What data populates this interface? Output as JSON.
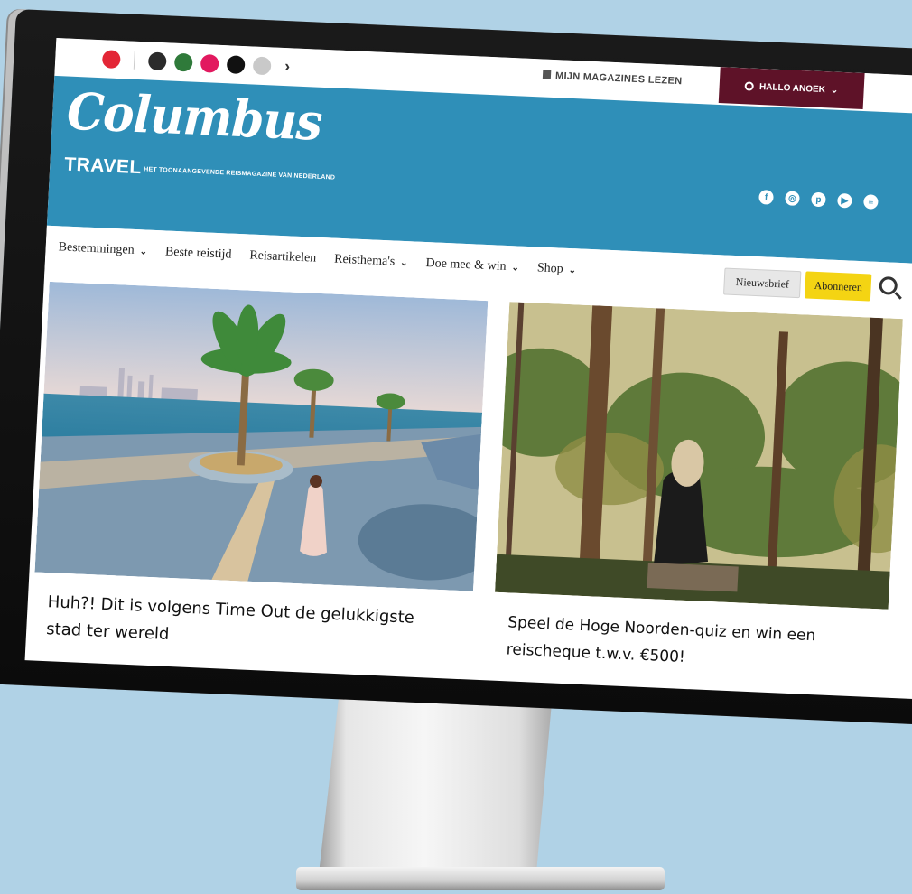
{
  "topbar": {
    "brand_icons": [
      {
        "icon": "red-ring-icon",
        "color": "#e32636"
      },
      {
        "icon": "h-brand-icon",
        "color": "#2b2b2b"
      },
      {
        "icon": "green-figure-icon",
        "color": "#2f7a3a"
      },
      {
        "icon": "pink-brand-icon",
        "color": "#e2195f"
      },
      {
        "icon": "black-brand-icon",
        "color": "#111111"
      },
      {
        "icon": "grey-brand-icon",
        "color": "#c9c9c9"
      }
    ],
    "next_chevron": "›",
    "magazines_label": "MIJN MAGAZINES LEZEN",
    "user_greeting": "HALLO ANOEK",
    "user_chevron": "⌄"
  },
  "header": {
    "logo": "Columbus",
    "logo_sub": "TRAVEL",
    "tagline": "HET TOONAANGEVENDE REISMAGAZINE VAN NEDERLAND",
    "social": [
      {
        "icon": "facebook-icon",
        "glyph": "f"
      },
      {
        "icon": "instagram-icon",
        "glyph": "◎"
      },
      {
        "icon": "pinterest-icon",
        "glyph": "p"
      },
      {
        "icon": "youtube-icon",
        "glyph": "▶"
      },
      {
        "icon": "spotify-icon",
        "glyph": "≡"
      }
    ],
    "bg_color": "#2f8fb8"
  },
  "nav": {
    "items": [
      {
        "label": "Bestemmingen",
        "dropdown": true
      },
      {
        "label": "Beste reistijd",
        "dropdown": false
      },
      {
        "label": "Reisartikelen",
        "dropdown": false
      },
      {
        "label": "Reisthema's",
        "dropdown": true
      },
      {
        "label": "Doe mee & win",
        "dropdown": true
      },
      {
        "label": "Shop",
        "dropdown": true
      }
    ],
    "newsletter": "Nieuwsbrief",
    "subscribe": "Abonneren",
    "accent": "#f4d413"
  },
  "cards": [
    {
      "title": "Huh?! Dit is volgens Time Out de gelukkigste stad ter wereld"
    },
    {
      "title": "Speel de Hoge Noorden-quiz en win een reischeque t.w.v. €500!"
    }
  ]
}
